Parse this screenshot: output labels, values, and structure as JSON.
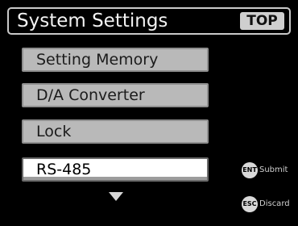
{
  "header": {
    "title": "System Settings",
    "top_button_label": "TOP"
  },
  "menu": {
    "items": [
      {
        "label": "Setting Memory",
        "selected": false
      },
      {
        "label": "D/A Converter",
        "selected": false
      },
      {
        "label": "Lock",
        "selected": false
      },
      {
        "label": "RS-485",
        "selected": true
      }
    ],
    "more_below_icon": "down-triangle"
  },
  "hints": {
    "submit": {
      "key": "ENT",
      "label": "Submit"
    },
    "discard": {
      "key": "ESC",
      "label": "Discard"
    }
  },
  "colors": {
    "background": "#000000",
    "item_background": "#b9b9b9",
    "selected_item_background": "#ffffff",
    "header_border": "#c9c9c9"
  }
}
